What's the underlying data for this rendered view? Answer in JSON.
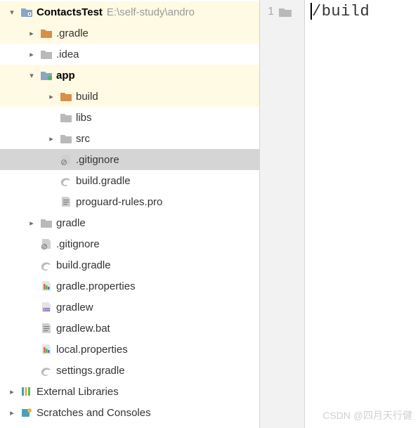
{
  "tree": {
    "root": {
      "label": "ContactsTest",
      "path_hint": "E:\\self-study\\andro"
    },
    "items": [
      {
        "label": ".gradle"
      },
      {
        "label": ".idea"
      },
      {
        "label": "app"
      },
      {
        "label": "build"
      },
      {
        "label": "libs"
      },
      {
        "label": "src"
      },
      {
        "label": ".gitignore"
      },
      {
        "label": "build.gradle"
      },
      {
        "label": "proguard-rules.pro"
      },
      {
        "label": "gradle"
      },
      {
        "label": ".gitignore"
      },
      {
        "label": "build.gradle"
      },
      {
        "label": "gradle.properties"
      },
      {
        "label": "gradlew"
      },
      {
        "label": "gradlew.bat"
      },
      {
        "label": "local.properties"
      },
      {
        "label": "settings.gradle"
      },
      {
        "label": "External Libraries"
      },
      {
        "label": "Scratches and Consoles"
      }
    ]
  },
  "editor": {
    "line_number": "1",
    "content": "/build"
  },
  "watermark": "CSDN @四月天行健"
}
